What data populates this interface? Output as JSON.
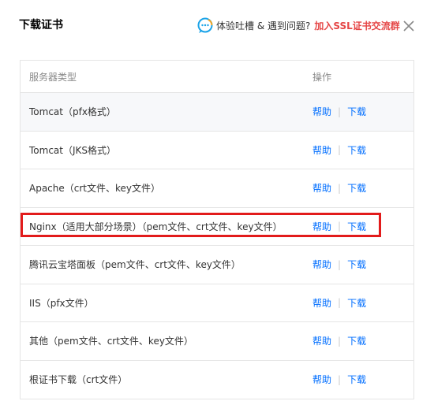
{
  "dialog": {
    "title": "下载证书",
    "feedback_text": "体验吐槽 & 遇到问题?",
    "join_link": "加入SSL证书交流群"
  },
  "table": {
    "header": {
      "type": "服务器类型",
      "op": "操作"
    },
    "rows": [
      {
        "name": "Tomcat（pfx格式）",
        "help": "帮助",
        "sep": "|",
        "download": "下载"
      },
      {
        "name": "Tomcat（JKS格式）",
        "help": "帮助",
        "sep": "|",
        "download": "下载"
      },
      {
        "name": "Apache（crt文件、key文件）",
        "help": "帮助",
        "sep": "|",
        "download": "下载"
      },
      {
        "name": "Nginx（适用大部分场景）（pem文件、crt文件、key文件）",
        "help": "帮助",
        "sep": "|",
        "download": "下载"
      },
      {
        "name": "腾讯云宝塔面板（pem文件、crt文件、key文件）",
        "help": "帮助",
        "sep": "|",
        "download": "下载"
      },
      {
        "name": "IIS（pfx文件）",
        "help": "帮助",
        "sep": "|",
        "download": "下载"
      },
      {
        "name": "其他（pem文件、crt文件、key文件）",
        "help": "帮助",
        "sep": "|",
        "download": "下载"
      },
      {
        "name": "根证书下载（crt文件）",
        "help": "帮助",
        "sep": "|",
        "download": "下载"
      }
    ]
  },
  "icons": {
    "feedback": "chat-bubble-icon",
    "close": "close-icon"
  },
  "colors": {
    "link": "#006eff",
    "accent_red": "#e54545",
    "highlight_box": "#e21b1b"
  }
}
